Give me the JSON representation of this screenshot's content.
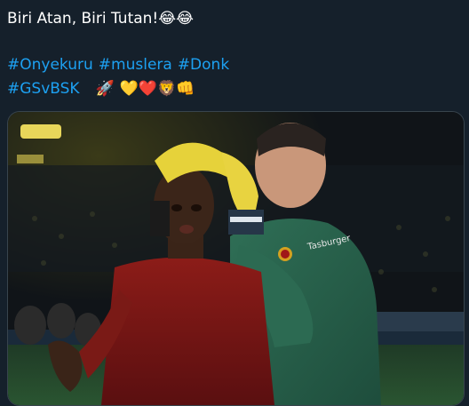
{
  "tweet": {
    "text_line1": "Biri Atan, Biri Tutan!",
    "line1_emojis": "😂😂",
    "hashtags_line2": [
      "#Onyekuru",
      "#muslera",
      "#Donk"
    ],
    "hashtag_line3": "#GSvBSK",
    "line3_emojis": [
      "🚀",
      "💛",
      "❤️",
      "🦁",
      "👊"
    ]
  },
  "media": {
    "jersey_text": "Tasburger"
  },
  "colors": {
    "background": "#15202b",
    "text": "#ffffff",
    "link": "#1da1f2"
  }
}
